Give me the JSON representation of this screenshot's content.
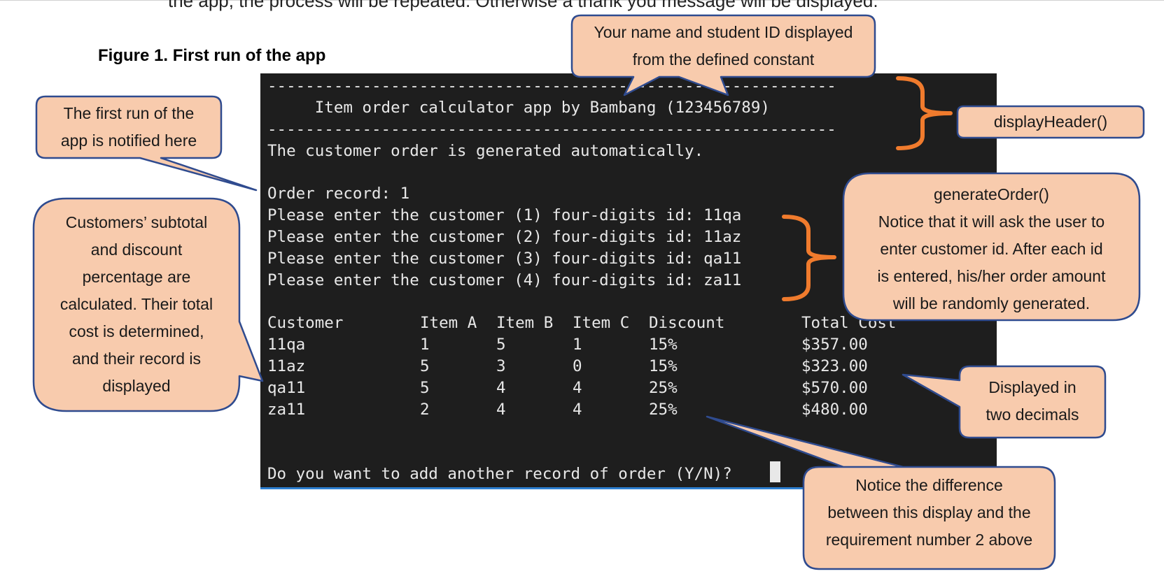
{
  "document": {
    "cut_off_text": "the app, the process will be repeated. Otherwise a thank you message will be displayed.",
    "figure_title": "Figure 1. First run of the app"
  },
  "terminal": {
    "separator": "------------------------------------------------------------",
    "header": "     Item order calculator app by Bambang (123456789)",
    "intro": "The customer order is generated automatically.",
    "order_record": "Order record: 1",
    "prompts": [
      "Please enter the customer (1) four-digits id: 11qa",
      "Please enter the customer (2) four-digits id: 11az",
      "Please enter the customer (3) four-digits id: qa11",
      "Please enter the customer (4) four-digits id: za11"
    ],
    "table": {
      "headers": [
        "Customer",
        "Item A",
        "Item B",
        "Item C",
        "Discount",
        "Total Cost"
      ],
      "rows": [
        [
          "11qa",
          "1",
          "5",
          "1",
          "15%",
          "$357.00"
        ],
        [
          "11az",
          "5",
          "3",
          "0",
          "15%",
          "$323.00"
        ],
        [
          "qa11",
          "5",
          "4",
          "4",
          "25%",
          "$570.00"
        ],
        [
          "za11",
          "2",
          "4",
          "4",
          "25%",
          "$480.00"
        ]
      ]
    },
    "final_prompt": "Do you want to add another record of order (Y/N)?"
  },
  "callouts": {
    "name_id": [
      "Your name and student ID displayed",
      "from the defined constant"
    ],
    "first_run": [
      "The first run of the",
      "app is notified here"
    ],
    "display_header": [
      "displayHeader()"
    ],
    "generate_order": [
      "generateOrder()",
      "Notice that it will ask the user to",
      "enter customer id. After each id",
      "is entered, his/her order amount",
      "will be randomly generated."
    ],
    "subtotal": [
      "Customers’ subtotal",
      "and discount",
      "percentage are",
      "calculated. Their total",
      "cost is determined,",
      "and their record is",
      "displayed"
    ],
    "two_decimals": [
      "Displayed in",
      "two decimals"
    ],
    "difference": [
      "Notice the difference",
      "between this display and the",
      "requirement number 2 above"
    ]
  },
  "colors": {
    "callout_fill": "#f8cbad",
    "callout_stroke": "#2f4b8f",
    "brace": "#f07b2d",
    "terminal_bg": "#1e1e1e",
    "terminal_text": "#e8e8e8"
  }
}
